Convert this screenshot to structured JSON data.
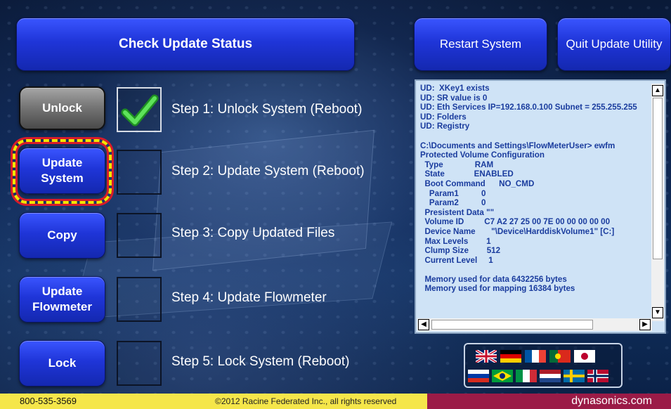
{
  "top_buttons": {
    "check_status": "Check Update Status",
    "restart": "Restart System",
    "quit": "Quit Update Utility"
  },
  "steps": [
    {
      "button_line1": "Unlock",
      "button_line2": "",
      "label": "Step 1: Unlock System (Reboot)",
      "checked": true
    },
    {
      "button_line1": "Update",
      "button_line2": "System",
      "label": "Step 2: Update System (Reboot)",
      "checked": false
    },
    {
      "button_line1": "Copy",
      "button_line2": "",
      "label": "Step 3: Copy Updated Files",
      "checked": false
    },
    {
      "button_line1": "Update",
      "button_line2": "Flowmeter",
      "label": "Step 4: Update Flowmeter",
      "checked": false
    },
    {
      "button_line1": "Lock",
      "button_line2": "",
      "label": "Step 5: Lock System (Reboot)",
      "checked": false
    }
  ],
  "log_lines": [
    "UD:  XKey1 exists",
    "UD: SR value is 0",
    "UD: Eth Services IP=192.168.0.100 Subnet = 255.255.255",
    "UD: Folders",
    "UD: Registry",
    "",
    "C:\\Documents and Settings\\FlowMeterUser> ewfm",
    "Protected Volume Configuration",
    "  Type              RAM",
    "  State             ENABLED",
    "  Boot Command      NO_CMD",
    "    Param1          0",
    "    Param2          0",
    "  Presistent Data \"\"",
    "  Volume ID         C7 A2 27 25 00 7E 00 00 00 00 00",
    "  Device Name       \"\\Device\\HarddiskVolume1\" [C:]",
    "  Max Levels        1",
    "  Clump Size        512",
    "  Current Level     1",
    "",
    "  Memory used for data 6432256 bytes",
    "  Memory used for mapping 16384 bytes"
  ],
  "scroll_icons": {
    "up": "▲",
    "down": "▼",
    "left": "◀",
    "right": "▶"
  },
  "flags": [
    "uk-flag",
    "germany-flag",
    "france-flag",
    "portugal-flag",
    "japan-flag",
    "russia-flag",
    "brazil-flag",
    "italy-flag",
    "netherlands-flag",
    "sweden-flag",
    "norway-flag"
  ],
  "footer": {
    "phone": "800-535-3569",
    "copyright": "©2012 Racine Federated Inc., all rights reserved",
    "site": "dynasonics.com"
  },
  "colors": {
    "button_blue": "#2a40e8",
    "button_gray": "#777777",
    "highlight_yellow": "#f2e600",
    "highlight_red": "#d81b2a",
    "check_green": "#3ec83a",
    "log_bg": "#cfe3f6",
    "log_text": "#1a3c9e",
    "footer_yellow": "#f5e64a",
    "footer_maroon": "#9b1b47"
  }
}
